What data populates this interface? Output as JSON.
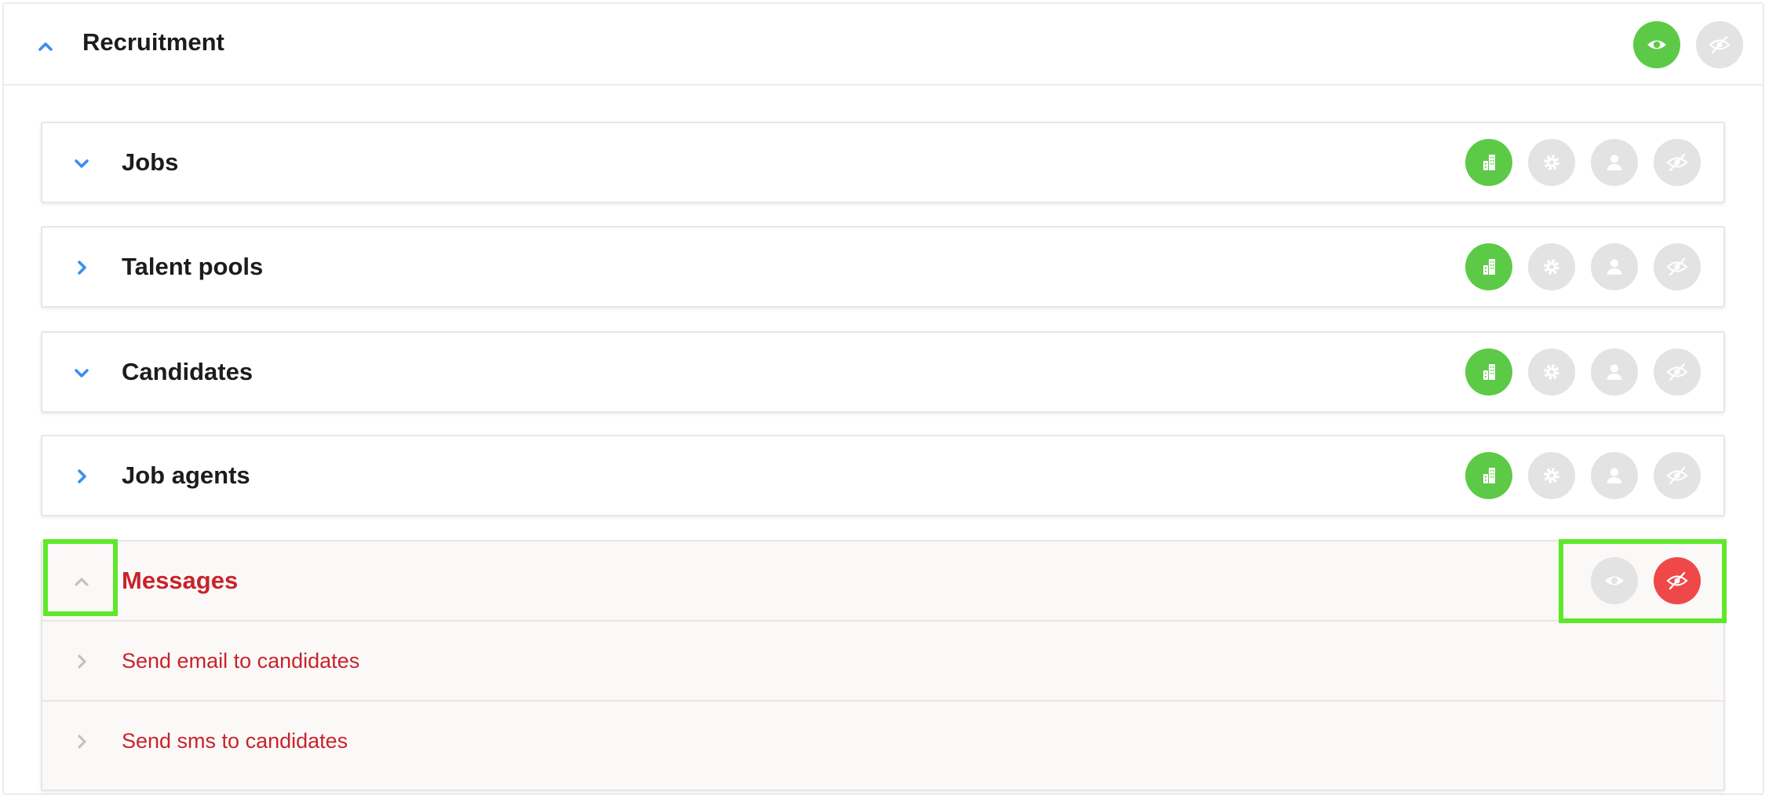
{
  "section": {
    "title": "Recruitment",
    "expanded": true,
    "actions": [
      {
        "icon": "eye-icon",
        "state": "active"
      },
      {
        "icon": "eye-slash-icon",
        "state": "inactive"
      }
    ]
  },
  "modules": [
    {
      "title": "Jobs",
      "caret": "chevron-down",
      "actions": [
        "building-icon",
        "gear-icon",
        "user-icon",
        "eye-slash-icon"
      ],
      "active": "building-icon"
    },
    {
      "title": "Talent pools",
      "caret": "chevron-right",
      "actions": [
        "building-icon",
        "gear-icon",
        "user-icon",
        "eye-slash-icon"
      ],
      "active": "building-icon"
    },
    {
      "title": "Candidates",
      "caret": "chevron-down",
      "actions": [
        "building-icon",
        "gear-icon",
        "user-icon",
        "eye-slash-icon"
      ],
      "active": "building-icon"
    },
    {
      "title": "Job agents",
      "caret": "chevron-right",
      "actions": [
        "building-icon",
        "gear-icon",
        "user-icon",
        "eye-slash-icon"
      ],
      "active": "building-icon"
    }
  ],
  "messages": {
    "title": "Messages",
    "expanded": true,
    "actions": [
      {
        "icon": "eye-icon",
        "state": "inactive"
      },
      {
        "icon": "eye-slash-icon",
        "state": "active"
      }
    ],
    "items": [
      {
        "label": "Send email to candidates"
      },
      {
        "label": "Send sms to candidates"
      }
    ]
  },
  "colors": {
    "accent_blue": "#3b8ef0",
    "active_green": "#5cca46",
    "hidden_red": "#ef4848",
    "inactive_grey": "#e3e3e3",
    "message_text": "#c8232a",
    "highlight": "#5fe82a"
  }
}
